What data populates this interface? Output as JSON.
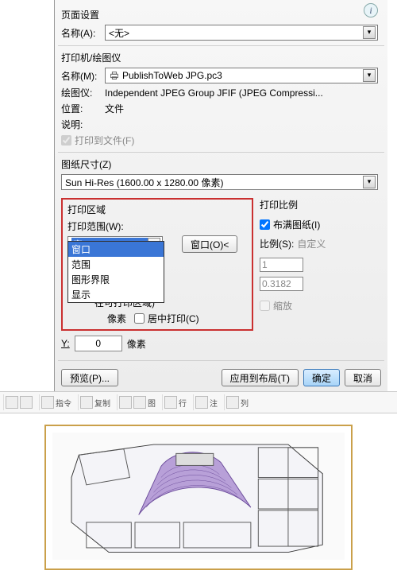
{
  "page_setup": {
    "title": "页面设置",
    "name_label": "名称(A):",
    "name_value": "<无>"
  },
  "printer": {
    "title": "打印机/绘图仪",
    "name_label": "名称(M):",
    "name_value": "PublishToWeb JPG.pc3",
    "plotter_label": "绘图仪:",
    "plotter_value": "Independent JPEG Group JFIF (JPEG Compressi...",
    "location_label": "位置:",
    "location_value": "文件",
    "desc_label": "说明:",
    "to_file_label": "打印到文件(F)"
  },
  "paper": {
    "title": "图纸尺寸(Z)",
    "value": "Sun Hi-Res (1600.00 x 1280.00 像素)"
  },
  "area": {
    "title": "打印区域",
    "range_label": "打印范围(W):",
    "selected": "窗口",
    "options": [
      "窗口",
      "范围",
      "图形界限",
      "显示"
    ],
    "window_btn": "窗口(O)<",
    "offset_note": "在可打印区域)",
    "unit": "像素",
    "center_label": "居中打印(C)",
    "y_label": "Y:",
    "y_value": "0"
  },
  "scale": {
    "title": "打印比例",
    "fit_label": "布满图纸(I)",
    "ratio_label": "比例(S):",
    "ratio_value": "自定义",
    "num1": "1",
    "num2": "0.3182",
    "shrink_label": "缩放"
  },
  "footer": {
    "preview": "预览(P)...",
    "apply": "应用到布局(T)",
    "ok": "确定",
    "cancel": "取消"
  },
  "toolbar": {
    "groups": [
      "指令",
      "复制",
      "图",
      "行",
      "注",
      "列"
    ]
  }
}
